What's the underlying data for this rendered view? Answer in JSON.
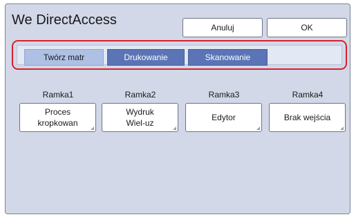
{
  "header": {
    "title": "We DirectAccess",
    "cancel_label": "Anuluj",
    "ok_label": "OK"
  },
  "tabs": [
    {
      "label": "Twórz matr",
      "active": true
    },
    {
      "label": "Drukowanie",
      "active": false
    },
    {
      "label": "Skanowanie",
      "active": false
    }
  ],
  "frames": [
    {
      "label": "Ramka1",
      "button": "Proces\nkropkowan"
    },
    {
      "label": "Ramka2",
      "button": "Wydruk\nWiel-uz"
    },
    {
      "label": "Ramka3",
      "button": "Edytor"
    },
    {
      "label": "Ramka4",
      "button": "Brak wejścia"
    }
  ],
  "colors": {
    "panel_background": "#d2d8e8",
    "tab_active": "#aec0e4",
    "tab_inactive": "#5a74b6",
    "highlight_border": "#d8202c"
  }
}
